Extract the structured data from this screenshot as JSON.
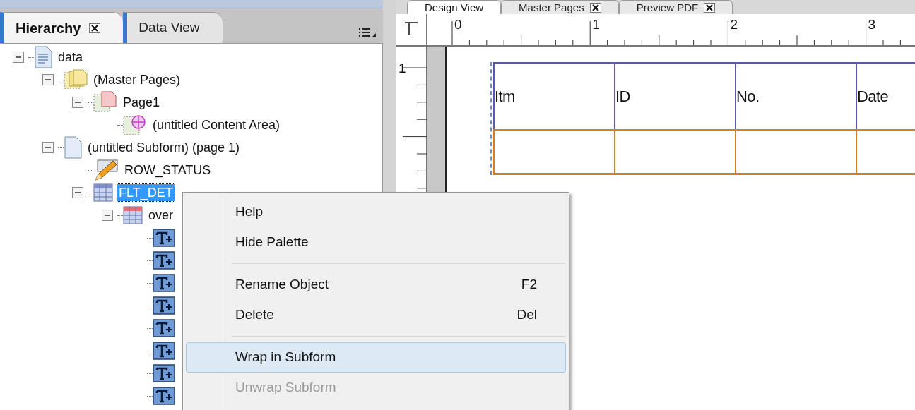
{
  "left_panel": {
    "tabs": [
      {
        "label": "Hierarchy",
        "selected": true,
        "closable": true
      },
      {
        "label": "Data View",
        "selected": false,
        "closable": false
      }
    ],
    "tree": [
      {
        "kind": "data",
        "label": "data",
        "selected": false,
        "expanded": true,
        "children": [
          {
            "kind": "master-pages",
            "label": "(Master Pages)",
            "selected": false,
            "expanded": true,
            "children": [
              {
                "kind": "page",
                "label": "Page1",
                "selected": false,
                "expanded": true,
                "children": [
                  {
                    "kind": "content-area",
                    "label": "(untitled Content Area)",
                    "selected": false
                  }
                ]
              }
            ]
          },
          {
            "kind": "subform",
            "label": "(untitled Subform) (page 1)",
            "selected": false,
            "expanded": true,
            "children": [
              {
                "kind": "pencil",
                "label": "ROW_STATUS",
                "selected": false
              },
              {
                "kind": "table",
                "label": "FLT_DET",
                "selected": true,
                "expanded": true,
                "children": [
                  {
                    "kind": "table-row",
                    "label": "over",
                    "selected": false,
                    "expanded": true,
                    "children": [
                      {
                        "kind": "text-field",
                        "selected": false
                      },
                      {
                        "kind": "text-field",
                        "selected": false
                      },
                      {
                        "kind": "text-field",
                        "selected": false
                      },
                      {
                        "kind": "text-field",
                        "selected": false
                      },
                      {
                        "kind": "text-field",
                        "selected": false
                      },
                      {
                        "kind": "text-field",
                        "selected": false
                      },
                      {
                        "kind": "text-field",
                        "selected": false
                      },
                      {
                        "kind": "text-field",
                        "selected": false
                      }
                    ]
                  }
                ]
              }
            ]
          }
        ]
      }
    ]
  },
  "design": {
    "tabs": [
      {
        "label": "Design View",
        "selected": true,
        "closable": false
      },
      {
        "label": "Master Pages",
        "selected": false,
        "closable": true
      },
      {
        "label": "Preview PDF",
        "selected": false,
        "closable": true
      }
    ],
    "ruler": {
      "x_labels": [
        "0",
        "1",
        "2",
        "3"
      ],
      "y_labels": [
        "1"
      ]
    },
    "table": {
      "columns": [
        "Itm",
        "ID",
        "No.",
        "Date"
      ]
    }
  },
  "context_menu": {
    "items": [
      {
        "kind": "item",
        "label": "Help",
        "selected": false,
        "disabled": false
      },
      {
        "kind": "item",
        "label": "Hide Palette",
        "selected": false,
        "disabled": false
      },
      {
        "kind": "separator"
      },
      {
        "kind": "item",
        "label": "Rename Object",
        "shortcut": "F2",
        "selected": false,
        "disabled": false
      },
      {
        "kind": "item",
        "label": "Delete",
        "shortcut": "Del",
        "selected": false,
        "disabled": false
      },
      {
        "kind": "separator"
      },
      {
        "kind": "item",
        "label": "Wrap in Subform",
        "selected": true,
        "disabled": false
      },
      {
        "kind": "item",
        "label": "Unwrap Subform",
        "selected": false,
        "disabled": true
      }
    ]
  }
}
